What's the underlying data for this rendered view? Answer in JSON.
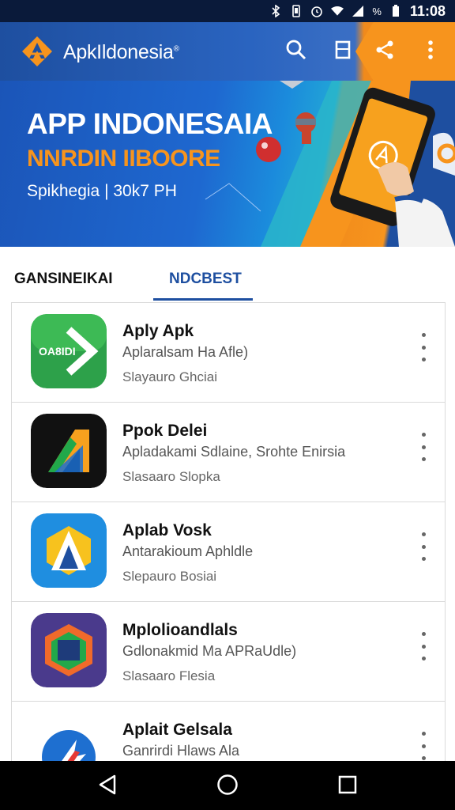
{
  "status_bar": {
    "time": "11:08",
    "battery": "%"
  },
  "app_bar": {
    "title": "ApkIldonesia",
    "reg_mark": "®"
  },
  "banner": {
    "title": "APP INDONESAIA",
    "subtitle": "NNRDIN IIBOORE",
    "tagline": "Spikhegia | 30k7 PH"
  },
  "tabs": [
    {
      "label": "GANSINEIKAI"
    },
    {
      "label": "NDCBEST",
      "selected": true
    }
  ],
  "items": [
    {
      "name": "Aply Apk",
      "desc": "Aplaralsam Ha Afle)",
      "sub": "Slayauro Ghciai",
      "icon_text": "OA8IDI"
    },
    {
      "name": "Ppok Delei",
      "desc": "Apladakami Sdlaine, Srohte Enirsia",
      "sub": "Slasaaro Slopka"
    },
    {
      "name": "Aplab Vosk",
      "desc": "Antarakioum Aphldle",
      "sub": "Slepauro Bosiai"
    },
    {
      "name": "Mplolioandlals",
      "desc": "Gdlonakmid Ma APRaUdle)",
      "sub": "Slasaaro Flesia"
    },
    {
      "name": "Aplait Gelsala",
      "desc": "Ganrirdi Hlaws Ala",
      "sub": ""
    }
  ],
  "colors": {
    "brand_blue": "#1e4fa0",
    "brand_orange": "#f7941d"
  }
}
